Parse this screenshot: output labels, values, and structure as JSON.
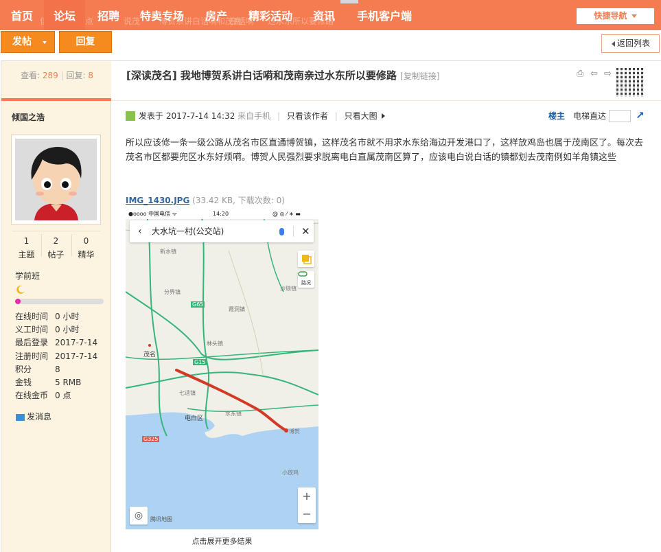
{
  "nav": {
    "tabs": [
      {
        "label": "首页"
      },
      {
        "label": "论坛"
      },
      {
        "label": "招聘"
      },
      {
        "label": "特卖专场"
      },
      {
        "label": "房产"
      },
      {
        "label": "精彩活动"
      },
      {
        "label": "资讯"
      },
      {
        "label": "手机客户端"
      }
    ],
    "quick_nav": "快捷导航",
    "ghost_text": [
      "信",
      "热点",
      "说茂",
      "博贺系讲白话嗬和茂南",
      "白话嗬",
      "过水东所以要修路"
    ]
  },
  "toolbar": {
    "post_label": "发帖",
    "reply_label": "回复",
    "back_label": "返回列表"
  },
  "stats": {
    "views_label": "查看:",
    "views": "289",
    "replies_label": "回复:",
    "replies": "8"
  },
  "user": {
    "name": "倾国之浩",
    "counts": [
      {
        "value": "1",
        "label": "主题"
      },
      {
        "value": "2",
        "label": "帖子"
      },
      {
        "value": "0",
        "label": "精华"
      }
    ],
    "level": "学前班",
    "level_progress_fraction": 0.06,
    "info": [
      {
        "key": "在线时间",
        "value": "0 小时"
      },
      {
        "key": "义工时间",
        "value": "0 小时"
      },
      {
        "key": "最后登录",
        "value": "2017-7-14"
      },
      {
        "key": "注册时间",
        "value": "2017-7-14"
      },
      {
        "key": "积分",
        "value": "8"
      },
      {
        "key": "金钱",
        "value": "5 RMB"
      },
      {
        "key": "在线金币",
        "value": "0 点"
      }
    ],
    "message_label": "发消息"
  },
  "post": {
    "title": "[深读茂名] 我地博贺系讲白话嗬和茂南亲过水东所以要修路",
    "copy_link": "[复制链接]",
    "posted_label": "发表于",
    "posted_time": "2017-7-14 14:32",
    "source": "来自手机",
    "only_author": "只看该作者",
    "big_image": "只看大图",
    "floor": "楼主",
    "elevator": "电梯直达",
    "body": "所以应该修一条一级公路从茂名市区直通博贺镇，这样茂名市就不用求水东给海边开发港口了，这样放鸡岛也属于茂南区了。每次去茂名市区都要兜区水东好烦嗬。博贺人民强烈要求脱离电白直属茂南区算了，应该电白说白话的镇都划去茂南例如羊角镇这些",
    "attachment_name": "IMG_1430.JPG",
    "attachment_meta": "(33.42 KB, 下载次数: 0)",
    "expand_label": "点击展开更多结果"
  },
  "map": {
    "status_left": "●oooo 中国电信 ᯤ",
    "status_time": "14:20",
    "status_right": "@ ◎ ⁄ ∗ ▬",
    "search_value": "大水坑一村(公交站)",
    "traffic_label": "路况",
    "brand": "腾讯地图",
    "labels": [
      "新水镇",
      "分界镇",
      "沙琅镇",
      "霞洞镇",
      "林头镇",
      "茂名",
      "七迳镇",
      "电白区",
      "博贺",
      "水东镇",
      "小放鸡",
      "G15",
      "G325",
      "G65"
    ]
  },
  "colors": {
    "nav_bg": "#f47c50",
    "button_orange": "#f58a1f",
    "sidebar_bg": "#fcf3e0",
    "route_red": "#d23a26"
  }
}
